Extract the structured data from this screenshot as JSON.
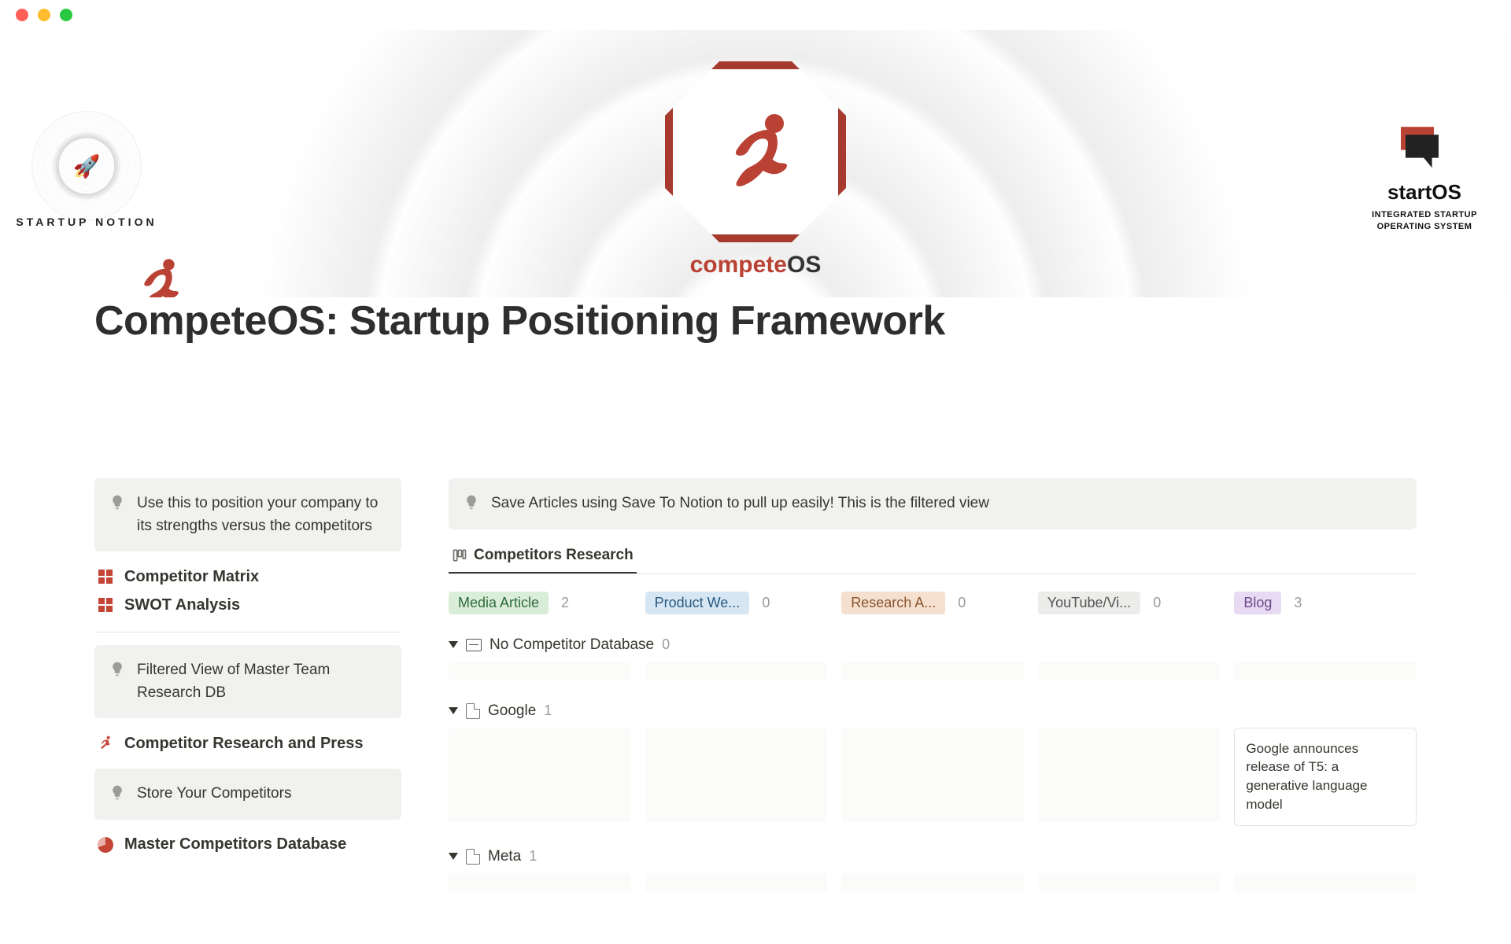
{
  "window": {
    "traffic": [
      "red",
      "yellow",
      "green"
    ]
  },
  "hero": {
    "left_badge": "STARTUP NOTION",
    "center_brand": {
      "prefix": "compete",
      "suffix": "OS"
    },
    "right_badge": {
      "brand": "startOS",
      "tagline1": "INTEGRATED STARTUP",
      "tagline2": "OPERATING SYSTEM"
    }
  },
  "page_icon": {
    "prefix": "compete",
    "suffix": "OS"
  },
  "title": "CompeteOS: Startup Positioning Framework",
  "sidebar": {
    "callout1": "Use this to position your company to its strengths versus the competitors",
    "items1": [
      {
        "label": "Competitor Matrix"
      },
      {
        "label": "SWOT Analysis"
      }
    ],
    "callout2": "Filtered View of Master Team Research DB",
    "item2": "Competitor Research and Press",
    "callout3": "Store Your Competitors",
    "item3": "Master Competitors Database"
  },
  "main": {
    "callout": "Save Articles using Save To Notion to pull up easily! This is the filtered view",
    "view_tab": "Competitors Research",
    "columns": [
      {
        "label": "Media Article",
        "count": "2",
        "class": "green"
      },
      {
        "label": "Product We...",
        "count": "0",
        "class": "blue"
      },
      {
        "label": "Research A...",
        "count": "0",
        "class": "orange"
      },
      {
        "label": "YouTube/Vi...",
        "count": "0",
        "class": "gray"
      },
      {
        "label": "Blog",
        "count": "3",
        "class": "purple"
      }
    ],
    "groups": [
      {
        "icon": "inbox",
        "label": "No Competitor Database",
        "count": "0"
      },
      {
        "icon": "doc",
        "label": "Google",
        "count": "1",
        "card_col": 4,
        "card_text": "Google announces release of T5: a generative language model"
      },
      {
        "icon": "doc",
        "label": "Meta",
        "count": "1"
      }
    ]
  }
}
